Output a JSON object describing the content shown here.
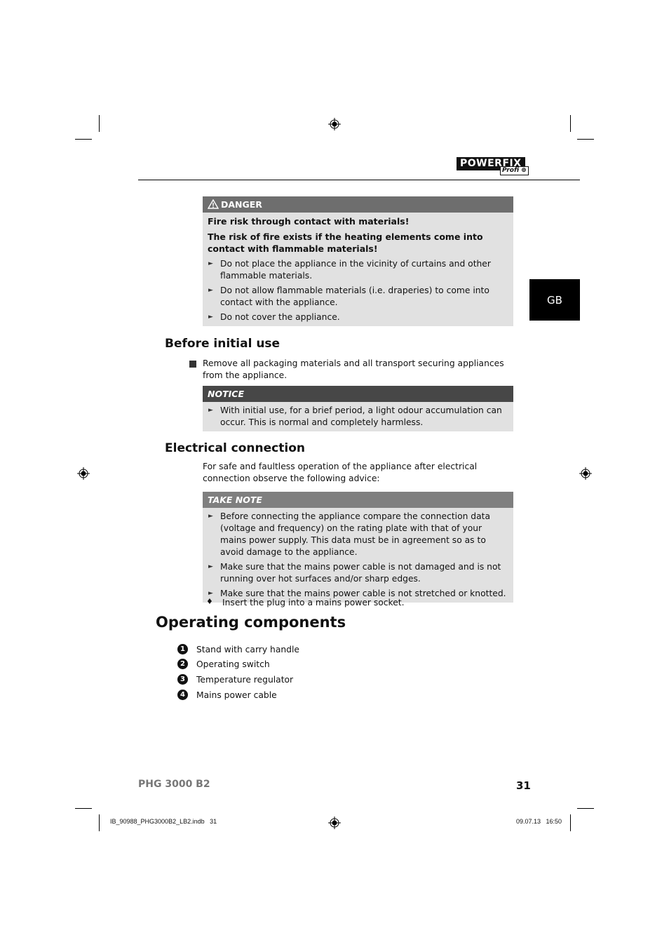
{
  "header": {
    "logo_main": "POWERFIX",
    "logo_sub": "Profi ⊕",
    "language_tab": "GB"
  },
  "danger_box": {
    "icon": "warning-triangle-icon",
    "title": "DANGER",
    "heading1": "Fire risk through contact with materials!",
    "heading2": "The risk of fire exists if the heating elements come into contact with flammable materials!",
    "items": [
      "Do not place the appliance in the vicinity of curtains and other flammable materials.",
      "Do not allow flammable materials (i.e. draperies) to come into contact with the appliance.",
      "Do not cover the appliance."
    ]
  },
  "before_initial_use": {
    "title": "Before initial use",
    "bullet": "Remove all packaging materials and all transport securing appliances from the appliance.",
    "notice": {
      "title": "NOTICE",
      "items": [
        "With initial use, for a brief period, a light odour accumulation can occur. This is normal and completely harmless."
      ]
    }
  },
  "electrical_connection": {
    "title": "Electrical connection",
    "intro": "For safe and faultless operation of the appliance after electrical connection observe the following advice:",
    "take_note": {
      "title": "TAKE NOTE",
      "items": [
        "Before connecting the appliance compare the connection data (voltage and frequency) on the rating plate with that of your mains power supply. This data must be in agreement so as to avoid damage to the appliance.",
        "Make sure that the mains power cable is not damaged and is not running over hot surfaces and/or sharp edges.",
        "Make sure that the mains power cable is not stretched or knotted."
      ]
    },
    "action": "Insert the plug into a mains power socket."
  },
  "operating_components": {
    "title": "Operating components",
    "items": [
      {
        "num": "1",
        "label": "Stand with carry handle"
      },
      {
        "num": "2",
        "label": "Operating switch"
      },
      {
        "num": "3",
        "label": "Temperature regulator"
      },
      {
        "num": "4",
        "label": "Mains power cable"
      }
    ]
  },
  "footer": {
    "model": "PHG 3000 B2",
    "page_number": "31",
    "slug_file": "IB_90988_PHG3000B2_LB2.indb   31",
    "slug_date": "09.07.13   16:50"
  },
  "colors": {
    "danger_header": "#6e6e6e",
    "notice_header": "#474747",
    "takenote_header": "#7f7f7f",
    "box_background": "#e1e1e1",
    "footer_model": "#777777"
  }
}
